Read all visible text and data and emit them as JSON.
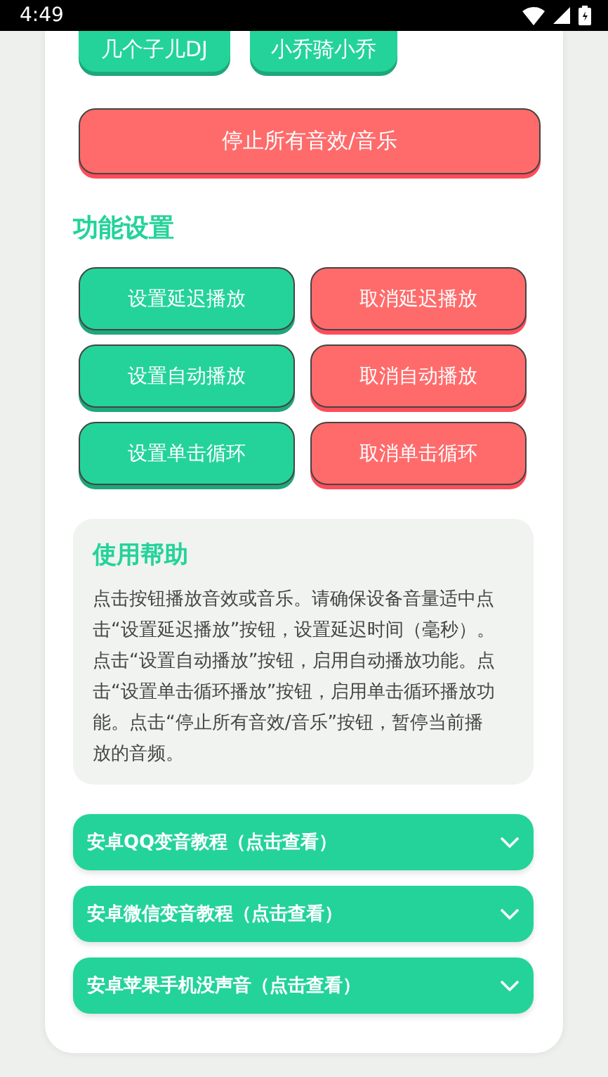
{
  "status_bar": {
    "time": "4:49"
  },
  "sound_buttons": [
    "几个子儿DJ",
    "小乔骑小乔"
  ],
  "stop_button": "停止所有音效/音乐",
  "settings": {
    "title": "功能设置",
    "buttons": [
      {
        "label": "设置延迟播放",
        "kind": "set"
      },
      {
        "label": "取消延迟播放",
        "kind": "cancel"
      },
      {
        "label": "设置自动播放",
        "kind": "set"
      },
      {
        "label": "取消自动播放",
        "kind": "cancel"
      },
      {
        "label": "设置单击循环",
        "kind": "set"
      },
      {
        "label": "取消单击循环",
        "kind": "cancel"
      }
    ]
  },
  "help": {
    "title": "使用帮助",
    "text": "点击按钮播放音效或音乐。请确保设备音量适中点击“设置延迟播放”按钮，设置延迟时间（毫秒）。点击“设置自动播放”按钮，启用自动播放功能。点击“设置单击循环播放”按钮，启用单击循环播放功能。点击“停止所有音效/音乐”按钮，暂停当前播放的音频。"
  },
  "tutorials": [
    {
      "label": "安卓QQ变音教程（点击查看）",
      "expanded": false
    },
    {
      "label": "安卓微信变音教程（点击查看）",
      "expanded": false
    },
    {
      "label": "安卓苹果手机没声音（点击查看）",
      "expanded": false
    }
  ]
}
